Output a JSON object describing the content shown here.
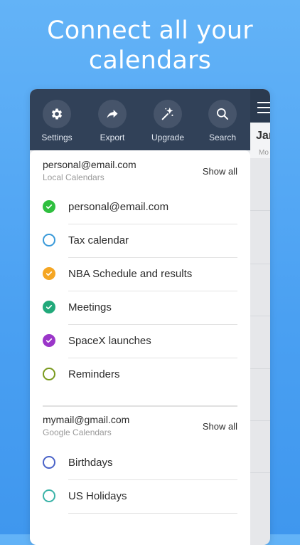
{
  "headline": {
    "line1": "Connect all your",
    "line2": "calendars"
  },
  "background_calendar": {
    "month": "Jan",
    "weekday": "Mo"
  },
  "toolbar": {
    "items": [
      {
        "label": "Settings",
        "icon": "gear-icon"
      },
      {
        "label": "Export",
        "icon": "share-icon"
      },
      {
        "label": "Upgrade",
        "icon": "magic-wand-icon"
      },
      {
        "label": "Search",
        "icon": "search-icon"
      }
    ]
  },
  "accounts": [
    {
      "email": "personal@email.com",
      "type": "Local Calendars",
      "show_all": "Show all",
      "calendars": [
        {
          "name": "personal@email.com",
          "checked": true,
          "color": "#2fbf3f"
        },
        {
          "name": "Tax calendar",
          "checked": false,
          "color": "#3a9ad9"
        },
        {
          "name": "NBA Schedule and results",
          "checked": true,
          "color": "#f5a623"
        },
        {
          "name": "Meetings",
          "checked": true,
          "color": "#21a97a"
        },
        {
          "name": "SpaceX launches",
          "checked": true,
          "color": "#9b36c9"
        },
        {
          "name": "Reminders",
          "checked": false,
          "color": "#7a9a1e"
        }
      ]
    },
    {
      "email": "mymail@gmail.com",
      "type": "Google Calendars",
      "show_all": "Show all",
      "calendars": [
        {
          "name": "Birthdays",
          "checked": false,
          "color": "#4a63c8"
        },
        {
          "name": "US Holidays",
          "checked": false,
          "color": "#3bb3a8"
        }
      ]
    }
  ]
}
